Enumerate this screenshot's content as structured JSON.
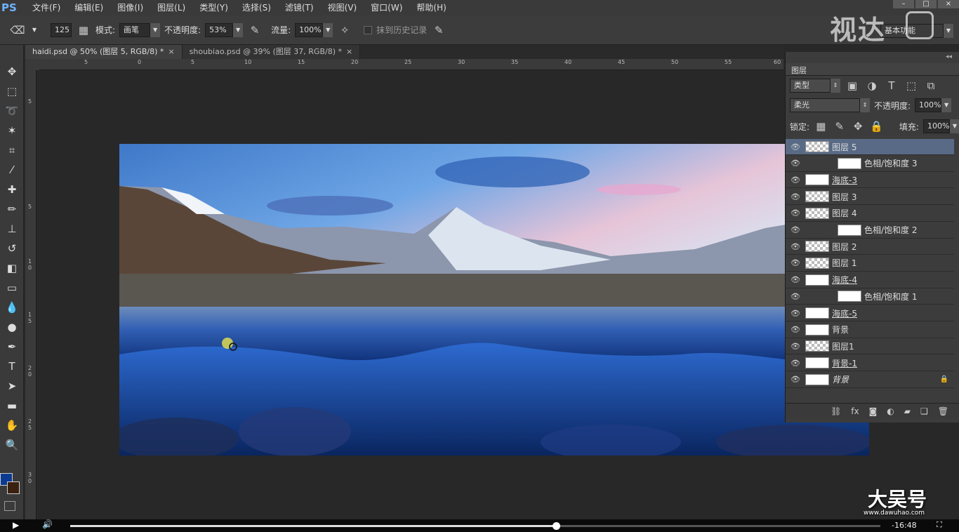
{
  "app": {
    "logo": "PS"
  },
  "menubar": [
    "文件(F)",
    "编辑(E)",
    "图像(I)",
    "图层(L)",
    "类型(Y)",
    "选择(S)",
    "滤镜(T)",
    "视图(V)",
    "窗口(W)",
    "帮助(H)"
  ],
  "options": {
    "brush_size": "125",
    "mode_label": "模式:",
    "mode_value": "画笔",
    "opacity_label": "不透明度:",
    "opacity_value": "53%",
    "flow_label": "流量:",
    "flow_value": "100%",
    "history_label": "抹到历史记录",
    "workspace": "基本功能"
  },
  "tabs": [
    {
      "label": "haidi.psd @ 50% (图层 5, RGB/8) *",
      "close": "×"
    },
    {
      "label": "shoubiao.psd @ 39% (图层 37, RGB/8) *",
      "close": "×"
    }
  ],
  "ruler": {
    "h": [
      "5",
      "0",
      "5",
      "10",
      "15",
      "20",
      "25",
      "30",
      "35",
      "40",
      "45",
      "50",
      "55",
      "60"
    ],
    "v": [
      "5",
      "5",
      "1 0",
      "1 5",
      "2 0",
      "2 5",
      "3 0"
    ]
  },
  "panel": {
    "title": "图层",
    "filter_type": "类型",
    "blend_mode": "柔光",
    "opacity_label": "不透明度:",
    "opacity_value": "100%",
    "lock_label": "锁定:",
    "fill_label": "填充:",
    "fill_value": "100%"
  },
  "layers": [
    {
      "name": "图层 5",
      "thumb": "checker",
      "selected": true
    },
    {
      "name": "色相/饱和度 3",
      "thumb": "white",
      "adj": true
    },
    {
      "name": "海底-3",
      "thumb": "white",
      "ul": true
    },
    {
      "name": "图层 3",
      "thumb": "checker"
    },
    {
      "name": "图层 4",
      "thumb": "checker"
    },
    {
      "name": "色相/饱和度 2",
      "thumb": "white",
      "adj": true
    },
    {
      "name": "图层 2",
      "thumb": "checker"
    },
    {
      "name": "图层 1",
      "thumb": "checker"
    },
    {
      "name": "海底-4",
      "thumb": "white",
      "ul": true
    },
    {
      "name": "色相/饱和度 1",
      "thumb": "white",
      "adj": true
    },
    {
      "name": "海底-5",
      "thumb": "white",
      "ul": true
    },
    {
      "name": "背景",
      "thumb": "white"
    },
    {
      "name": "图层1",
      "thumb": "checker"
    },
    {
      "name": "背景-1",
      "thumb": "white",
      "ul": true
    },
    {
      "name": "背景",
      "thumb": "white",
      "it": true,
      "lock": true
    }
  ],
  "player": {
    "time": "-16:48",
    "progress": 0.6
  },
  "watermarks": {
    "top": "视达",
    "bottom": "大吴号",
    "bottom_url": "www.dawuhao.com"
  }
}
